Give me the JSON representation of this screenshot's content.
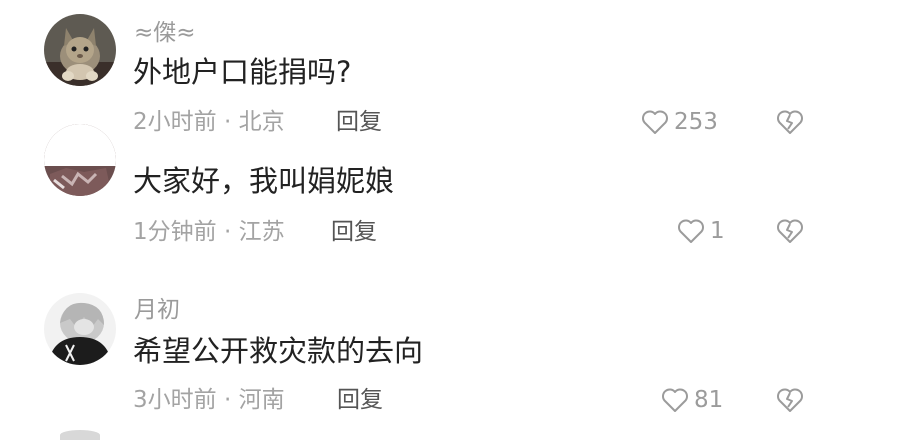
{
  "comments": [
    {
      "username": "≈傑≈",
      "text": "外地户口能捐吗?",
      "meta": "2小时前 · 北京",
      "reply_label": "回复",
      "likes": "253",
      "avatar_icon": "cat-avatar"
    },
    {
      "username": "",
      "text": "大家好，我叫娟妮娘",
      "meta": "1分钟前 · 江苏",
      "reply_label": "回复",
      "likes": "1",
      "avatar_icon": "photo-avatar"
    },
    {
      "username": "月初",
      "text": "希望公开救灾款的去向",
      "meta": "3小时前 · 河南",
      "reply_label": "回复",
      "likes": "81",
      "avatar_icon": "anime-avatar"
    }
  ],
  "colors": {
    "text": "#222222",
    "meta": "#a3a3a3",
    "icon": "#9b9b9b"
  }
}
